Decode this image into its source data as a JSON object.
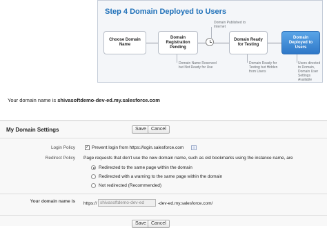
{
  "diagram": {
    "title": "Step 4  Domain Deployed to Users",
    "boxes": [
      "Choose Domain Name",
      "Domain Registration Pending",
      "Domain Ready for Testing",
      "Domain Deployed to Users"
    ],
    "notes": {
      "published": "Domain Published to Internet",
      "reserved": "Domain Name Reserved but Not Ready for Use",
      "testing": "Domain Ready for Testing but Hidden from Users",
      "redirected": "Users directed to Domain, Domain User Settings Available"
    }
  },
  "domain_line": {
    "prefix": "Your domain name is ",
    "domain": "shivasoftdemo-dev-ed.my.salesforce.com"
  },
  "settings": {
    "title": "My Domain Settings",
    "save_label": "Save",
    "cancel_label": "Cancel",
    "login_policy": {
      "label": "Login Policy",
      "checkbox_text": "Prevent login from https://login.salesforce.com",
      "checked": true
    },
    "redirect_policy": {
      "label": "Redirect Policy",
      "description": "Page requests that don't use the new domain name, such as old bookmarks using the instance name, are",
      "options": [
        "Redirected to the same page within the domain",
        "Redirected with a warning to the same page within the domain",
        "Not redirected (Recommended)"
      ],
      "selected_index": 0
    },
    "domain_field": {
      "label": "Your domain name is",
      "prefix": "https://",
      "value": "shivasoftdemo-dev-ed",
      "suffix": "-dev-ed.my.salesforce.com/"
    }
  }
}
